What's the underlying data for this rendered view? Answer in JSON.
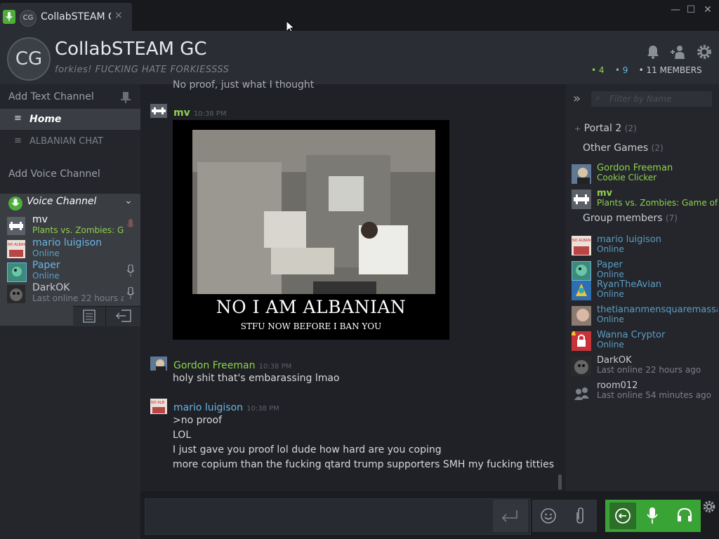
{
  "tab": {
    "title": "CollabSTEAM G",
    "avatar_text": "CG",
    "close": "×"
  },
  "window": {
    "min": "—",
    "max": "☐",
    "close": "✕"
  },
  "header": {
    "avatar_text": "CG",
    "title": "CollabSTEAM GC",
    "tagline": "forkies! FUCKING HATE FORKIESSSS",
    "count_ingame": "4",
    "count_online": "9",
    "count_members": "11 MEMBERS"
  },
  "sidebar": {
    "add_text_channel": "Add Text Channel",
    "channels": [
      {
        "label": "Home"
      },
      {
        "label": "ALBANIAN CHAT"
      }
    ],
    "add_voice_channel": "Add Voice Channel",
    "voice_channel": "Voice Channel",
    "voice_users": [
      {
        "name": "mv",
        "status": "Plants vs. Zombies: Ga"
      },
      {
        "name": "mario luigison",
        "status": "Online"
      },
      {
        "name": "Paper",
        "status": "Online"
      },
      {
        "name": "DarkOK",
        "status": "Last online 22 hours a"
      }
    ]
  },
  "chat": {
    "top_text": "No proof, just what I thought",
    "messages": [
      {
        "name": "mv",
        "time": "10:38 PM",
        "lines": []
      },
      {
        "name": "Gordon Freeman",
        "time": "10:38 PM",
        "lines": [
          "holy shit that's embarassing lmao"
        ]
      },
      {
        "name": "mario luigison",
        "time": "10:38 PM",
        "lines": [
          ">no proof",
          "LOL",
          "I just gave you proof lol dude how hard are you coping",
          "more copium than the fucking qtard trump supporters SMH my fucking titties"
        ]
      }
    ],
    "meme": {
      "caption": "NO I AM ALBANIAN",
      "subcaption": "STFU NOW BEFORE I BAN YOU"
    }
  },
  "members": {
    "filter_placeholder": "Filter by Name",
    "sections": {
      "portal": {
        "label": "Portal 2",
        "count": "(2)"
      },
      "other_games": {
        "label": "Other Games",
        "count": "(2)"
      },
      "group_members": {
        "label": "Group members",
        "count": "(7)"
      }
    },
    "ingame": [
      {
        "name": "Gordon Freeman",
        "status": "Cookie Clicker"
      },
      {
        "name": "mv",
        "status": "Plants vs. Zombies: Game of t"
      }
    ],
    "list": [
      {
        "name": "mario luigison",
        "status": "Online"
      },
      {
        "name": "Paper",
        "status": "Online"
      },
      {
        "name": "RyanTheAvian",
        "status": "Online"
      },
      {
        "name": "thetiananmensquaremassa",
        "status": "Online"
      },
      {
        "name": "Wanna Cryptor",
        "status": "Online"
      },
      {
        "name": "DarkOK",
        "status": "Last online 22 hours ago"
      },
      {
        "name": "room012",
        "status": "Last online 54 minutes ago"
      }
    ]
  },
  "colors": {
    "ingame": "#8fd14f",
    "online": "#6ab5e6",
    "voice_green": "#3aa335"
  },
  "icons": [
    "microphone-icon",
    "bell-icon",
    "add-friend-icon",
    "gear-icon",
    "headset-icon",
    "emoji-icon",
    "paperclip-icon",
    "send-icon",
    "leave-icon",
    "notes-icon",
    "chevron-down-icon",
    "collapse-icon",
    "search-icon"
  ]
}
